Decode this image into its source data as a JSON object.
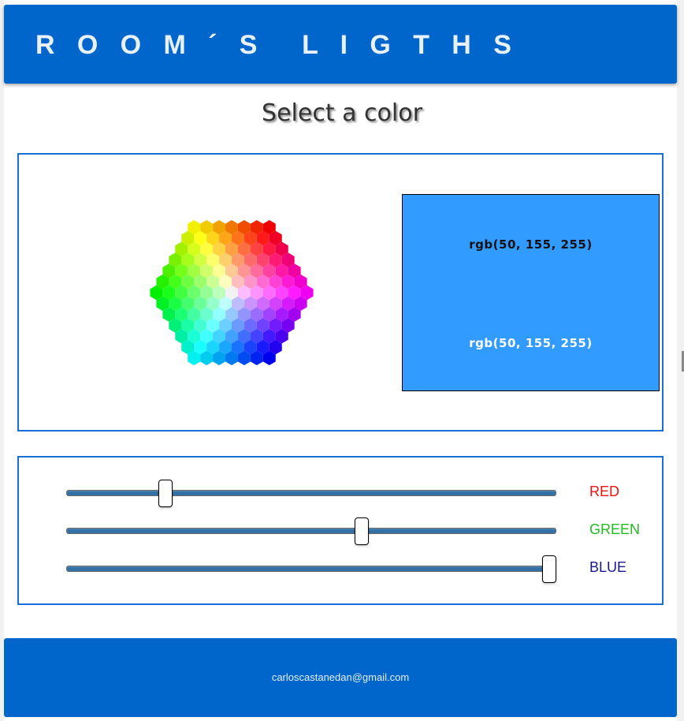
{
  "header": {
    "title": "R   O   O   M   ´   S      L   I   G   T   H   S"
  },
  "main": {
    "subtitle": "Select a color",
    "picker": {
      "icon": "color-hexagon-palette"
    },
    "preview": {
      "color": "#329bff",
      "text_top": "rgb(50, 155, 255)",
      "text_bottom": "rgb(50, 155, 255)"
    }
  },
  "sliders": [
    {
      "label": "RED",
      "value": 50,
      "max": 255,
      "color": "#ee1111"
    },
    {
      "label": "GREEN",
      "value": 155,
      "max": 255,
      "color": "#22bb22"
    },
    {
      "label": "BLUE",
      "value": 255,
      "max": 255,
      "color": "#1a1a8c"
    }
  ],
  "footer": {
    "email": "carloscastanedan@gmail.com"
  },
  "theme": {
    "accent": "#0066cc",
    "border": "#1a6fd6",
    "track": "#3270a6"
  }
}
